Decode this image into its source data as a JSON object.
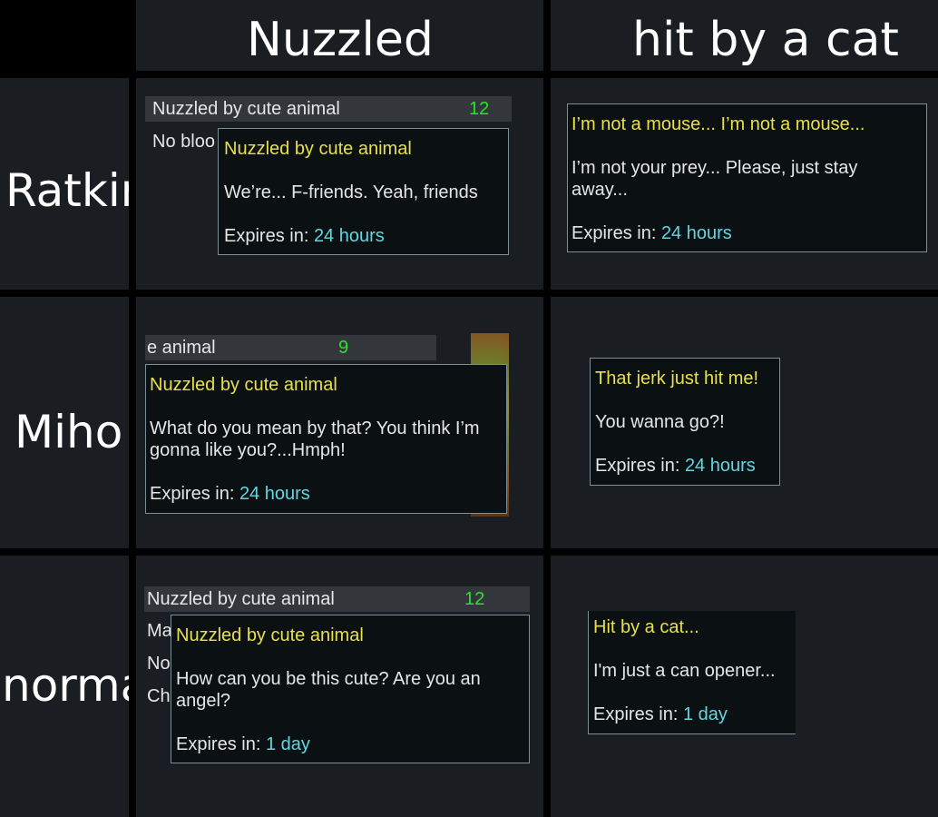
{
  "columns": [
    "Nuzzled",
    "hit by a cat"
  ],
  "rows": [
    "Ratkin",
    "Miho",
    "normal"
  ],
  "expires_label": "Expires in: ",
  "colors": {
    "title": "#e8e04a",
    "value": "#2ee02e",
    "expire": "#63d6e0"
  },
  "ratkin": {
    "nuzzled": {
      "bar_label": "Nuzzled by cute animal",
      "bar_value": "12",
      "bg_text": "No bloo",
      "tip": {
        "title": "Nuzzled by cute animal",
        "body": "We’re... F-friends. Yeah, friends",
        "expires": "24 hours"
      }
    },
    "hit": {
      "tip": {
        "title": "I’m not a mouse... I’m not a mouse...",
        "body": "I’m not your prey... Please, just stay away...",
        "expires": "24 hours"
      }
    }
  },
  "miho": {
    "nuzzled": {
      "bar_label": "e animal",
      "bar_value": "9",
      "tip": {
        "title": "Nuzzled by cute animal",
        "body": "What do you mean by that? You think I’m gonna like you?...Hmph!",
        "expires": "24 hours"
      }
    },
    "hit": {
      "tip": {
        "title": "That jerk just hit me!",
        "body": "You wanna go?!",
        "expires": "24 hours"
      }
    }
  },
  "normal": {
    "nuzzled": {
      "bar_label": "Nuzzled by cute animal",
      "bar_value": "12",
      "bg_lines": [
        "Ma",
        "No",
        "Ch"
      ],
      "tip": {
        "title": "Nuzzled by cute animal",
        "body": "How can you be this cute? Are you an angel?",
        "expires": "1 day"
      }
    },
    "hit": {
      "tip": {
        "title": "Hit by a cat...",
        "body": "I'm just a can opener...",
        "expires": "1 day"
      }
    }
  }
}
